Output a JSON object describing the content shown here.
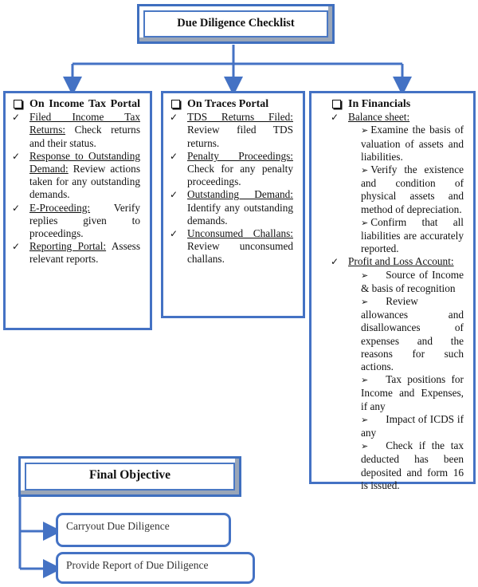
{
  "title": "Due Diligence Checklist",
  "colors": {
    "accent": "#4472c4",
    "bevel_shadow": "#9aa6b8"
  },
  "columns": [
    {
      "header": "On Income Tax Portal",
      "items": [
        {
          "label": "Filed Income Tax Returns:",
          "text": "Check returns and their status."
        },
        {
          "label": "Response to Outstanding Demand:",
          "text": "Review actions taken for any outstanding demands."
        },
        {
          "label": "E-Proceeding:",
          "text": "Verify replies given to proceedings."
        },
        {
          "label": "Reporting Portal:",
          "text": "Assess relevant reports."
        }
      ]
    },
    {
      "header": "On Traces Portal",
      "items": [
        {
          "label": "TDS Returns Filed:",
          "text": "Review filed TDS returns."
        },
        {
          "label": "Penalty Proceedings:",
          "text": "Check for any penalty proceedings."
        },
        {
          "label": "Outstanding Demand:",
          "text": "Identify any outstanding demands."
        },
        {
          "label": "Unconsumed Challans:",
          "text": "Review unconsumed challans."
        }
      ]
    },
    {
      "header": "In Financials",
      "items": [
        {
          "label": "Balance sheet:",
          "subitems": [
            "Examine the basis of valuation of assets and liabilities.",
            "Verify the existence and condition of physical assets and method of depreciation.",
            "Confirm that all liabilities are accurately reported."
          ]
        },
        {
          "label": "Profit and Loss Account:",
          "subitems": [
            "Source of Income & basis of recognition",
            "Review allowances and disallowances of expenses and the reasons for such actions.",
            "Tax positions for Income and Expenses, if any",
            "Impact of ICDS if any",
            "Check if the tax deducted has been deposited and form 16 is issued."
          ]
        }
      ]
    }
  ],
  "final": {
    "title": "Final Objective",
    "objectives": [
      "Carryout Due Diligence",
      "Provide Report of Due Diligence"
    ]
  },
  "icons": {
    "header_bullet": "checkbox-icon",
    "item_bullet": "checkmark-icon",
    "sub_bullet": "arrowhead-icon"
  }
}
